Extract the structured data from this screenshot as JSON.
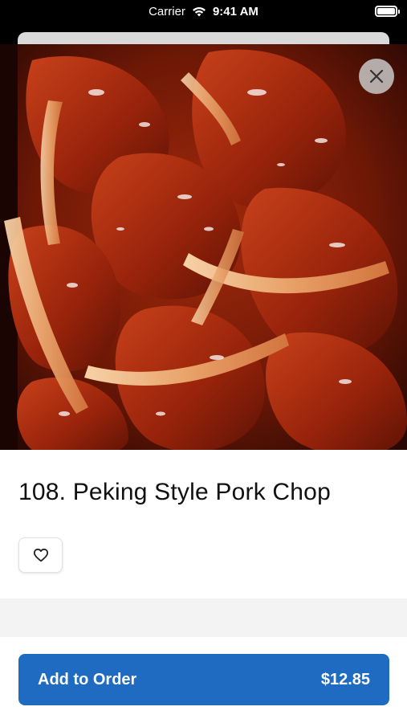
{
  "status_bar": {
    "carrier": "Carrier",
    "time": "9:41 AM"
  },
  "hero": {
    "image": "sauced-pork-chop-photo",
    "close_icon": "close-icon"
  },
  "item": {
    "title": "108. Peking Style Pork Chop",
    "favorite_icon": "heart-icon"
  },
  "order": {
    "label": "Add to Order",
    "price": "$12.85",
    "accent": "#1f6bc1"
  }
}
